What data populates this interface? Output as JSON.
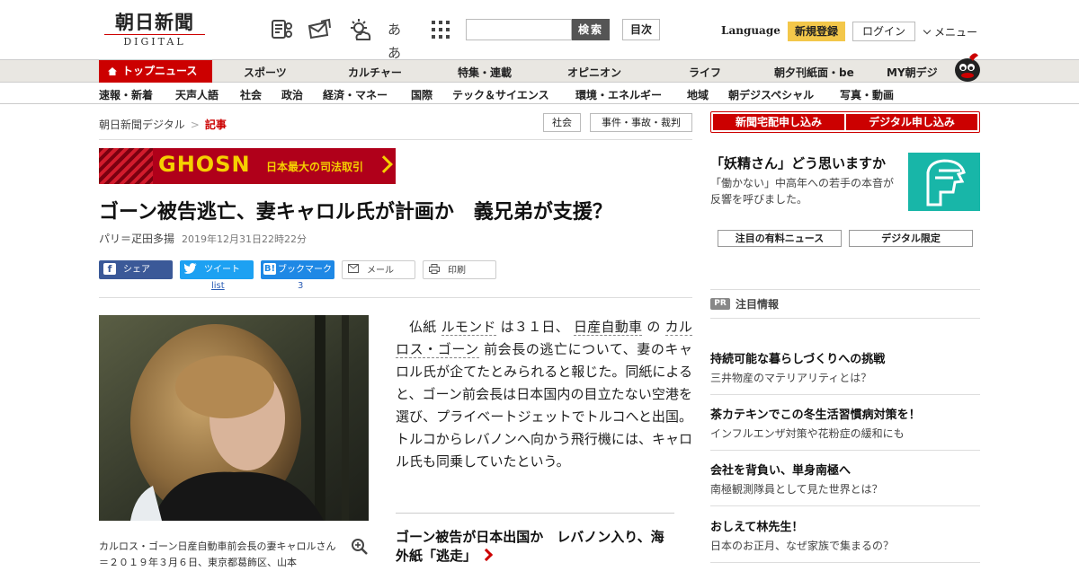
{
  "header": {
    "logo_jp": "朝日新聞",
    "logo_en": "DIGITAL",
    "icons": [
      "news-icon",
      "mail-icon",
      "weather-icon",
      "font-size-icon",
      "apps-grid-icon"
    ],
    "font_icon_text": "ああ",
    "search_placeholder": "",
    "search_label": "検索",
    "index_label": "目次",
    "language_label": "Language",
    "signup_label": "新規登録",
    "login_label": "ログイン",
    "menu_label": "メニュー"
  },
  "nav_primary": {
    "top_news": "トップニュース",
    "items": [
      "スポーツ",
      "カルチャー",
      "特集・連載",
      "オピニオン",
      "ライフ",
      "朝夕刊紙面・be",
      "MY朝デジ"
    ]
  },
  "nav_secondary": {
    "items": [
      "速報・新着",
      "天声人語",
      "社会",
      "政治",
      "経済・マネー",
      "国際",
      "テック＆サイエンス",
      "環境・エネルギー",
      "地域",
      "朝デジスペシャル",
      "写真・動画"
    ]
  },
  "breadcrumb": {
    "home": "朝日新聞デジタル",
    "separator": ">",
    "current": "記事"
  },
  "category_tags": [
    "社会",
    "事件・事故・裁判"
  ],
  "banner": {
    "big_text": "GHOSN",
    "small_text": "日本最大の司法取引"
  },
  "article": {
    "headline": "ゴーン被告逃亡、妻キャロル氏が計画か　義兄弟が支援？",
    "author": "パリ＝疋田多揚",
    "date": "2019年12月31日22時22分",
    "body_p1_pre": "仏紙",
    "body_link1": "ルモンド",
    "body_p1_mid1": "は３１日、",
    "body_link2": "日産自動車",
    "body_p1_mid2": "の",
    "body_link3": "カルロス・ゴーン",
    "body_p1_post": "前会長の逃亡について、妻のキャロル氏が企てたとみられると報じた。同紙によると、ゴーン前会長は日本国内の目立たない空港を選び、プライベートジェットでトルコへと出国。トルコからレバノンへ向かう飛行機には、キャロル氏も同乗していたという。",
    "photo_caption": "カルロス・ゴーン日産自動車前会長の妻キャロルさん＝２０１９年３月６日、東京都葛飾区、山本",
    "related_title": "ゴーン被告が日本出国か　レバノン入り、海外紙「逃走」"
  },
  "share": {
    "facebook": "シェア",
    "twitter": "ツイート",
    "hatena": "ブックマーク",
    "mail": "メール",
    "print": "印刷",
    "twitter_count": "list",
    "hatena_count": "3",
    "colors": {
      "facebook": "#3b5998",
      "twitter": "#1da1f2",
      "hatena": "#1e88e5"
    }
  },
  "sidebar": {
    "subscribe_paper": "新聞宅配申し込み",
    "subscribe_digital": "デジタル申し込み",
    "promo_title": "「妖精さん」どう思いますか",
    "promo_text": "「働かない」中高年への若手の本音が反響を呼びました。",
    "tab_paid": "注目の有料ニュース",
    "tab_digital": "デジタル限定",
    "pr_badge": "PR",
    "pr_title": "注目情報",
    "pr_items": [
      {
        "title": "持続可能な暮らしづくりへの挑戦",
        "sub": "三井物産のマテリアリティとは？"
      },
      {
        "title": "茶カテキンでこの冬生活習慣病対策を！",
        "sub": "インフルエンザ対策や花粉症の緩和にも"
      },
      {
        "title": "会社を背負い、単身南極へ",
        "sub": "南極観測隊員として見た世界とは？"
      },
      {
        "title": "おしえて林先生！",
        "sub": "日本のお正月、なぜ家族で集まるの？"
      }
    ]
  },
  "colors": {
    "brand_red": "#cc0000",
    "signup_yellow": "#f3c74a",
    "promo_teal": "#18b6a8"
  }
}
